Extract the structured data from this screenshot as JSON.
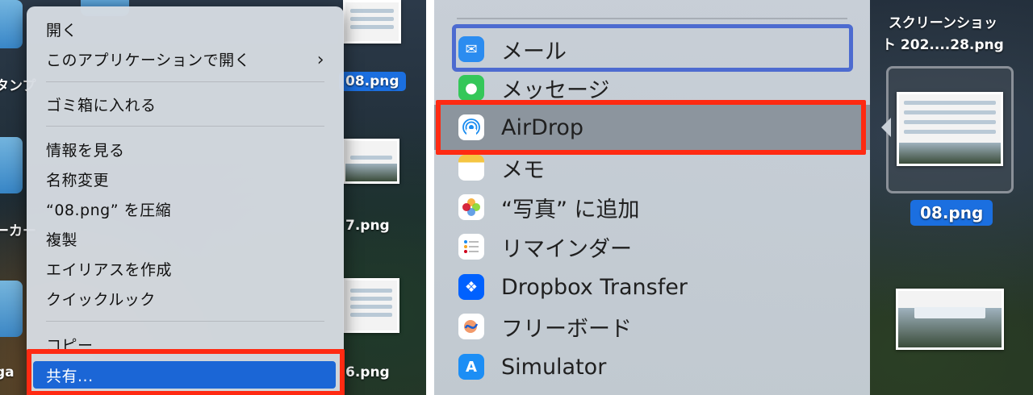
{
  "left": {
    "desktop_labels": {
      "frag_top": "タンプ",
      "frag_mid": "ーカー",
      "frag_bot": "ga",
      "file_08": "08.png",
      "file_07": "7.png",
      "file_06": "6.png"
    },
    "menu": {
      "open": "開く",
      "open_with": "このアプリケーションで開く",
      "trash": "ゴミ箱に入れる",
      "get_info": "情報を見る",
      "rename": "名称変更",
      "compress": "“08.png” を圧縮",
      "duplicate": "複製",
      "make_alias": "エイリアスを作成",
      "quick_look": "クイックルック",
      "copy": "コピー",
      "share": "共有..."
    }
  },
  "right": {
    "share_items": [
      {
        "label": "メール",
        "icon": "mail-icon",
        "color": "#2b8cf0"
      },
      {
        "label": "メッセージ",
        "icon": "messages-icon",
        "color": "#34c759"
      },
      {
        "label": "AirDrop",
        "icon": "airdrop-icon",
        "color": "#1a8cf0"
      },
      {
        "label": "メモ",
        "icon": "notes-icon",
        "color": "#f5c542"
      },
      {
        "label": "“写真” に追加",
        "icon": "photos-icon",
        "color": "#ffffff"
      },
      {
        "label": "リマインダー",
        "icon": "reminders-icon",
        "color": "#ffffff"
      },
      {
        "label": "Dropbox Transfer",
        "icon": "dropbox-icon",
        "color": "#0061fe"
      },
      {
        "label": "フリーボード",
        "icon": "freeform-icon",
        "color": "#ffffff"
      },
      {
        "label": "Simulator",
        "icon": "simulator-icon",
        "color": "#1c8ef5"
      }
    ],
    "desktop": {
      "title_line1": "スクリーンショッ",
      "title_line2": "ト 202....28.png",
      "selected_file": "08.png"
    }
  },
  "colors": {
    "highlight_red": "#ff2a12",
    "selection_blue": "#1b66d6",
    "focus_blue": "#4d6bd0"
  }
}
